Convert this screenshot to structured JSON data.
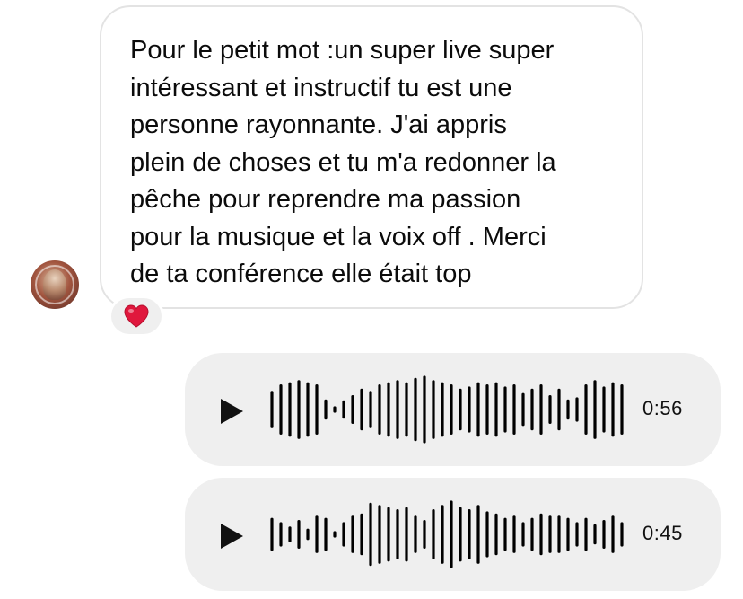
{
  "incoming_message": {
    "text": "Pour le petit mot :un super live super\nintéressant et instructif tu est une\npersonne rayonnante.  J'ai appris\nplein de choses et tu m'a redonner la\npêche pour reprendre ma passion\npour la musique et la voix off . Merci\nde ta conférence elle était top",
    "reaction_icon": "red-heart-icon",
    "reaction_color": "#e0173d"
  },
  "voice_messages": [
    {
      "duration": "0:56",
      "icons": {
        "play": "play-icon"
      },
      "waveform_levels": [
        0.4,
        0.55,
        0.6,
        0.65,
        0.6,
        0.55,
        0.2,
        0.02,
        0.18,
        0.3,
        0.45,
        0.4,
        0.55,
        0.6,
        0.65,
        0.6,
        0.7,
        0.75,
        0.65,
        0.6,
        0.55,
        0.45,
        0.5,
        0.6,
        0.55,
        0.6,
        0.5,
        0.55,
        0.35,
        0.45,
        0.55,
        0.3,
        0.45,
        0.2,
        0.25,
        0.55,
        0.65,
        0.5,
        0.6,
        0.55
      ]
    },
    {
      "duration": "0:45",
      "icons": {
        "play": "play-icon"
      },
      "waveform_levels": [
        0.35,
        0.25,
        0.15,
        0.3,
        0.1,
        0.4,
        0.35,
        0.02,
        0.25,
        0.4,
        0.45,
        0.7,
        0.65,
        0.6,
        0.55,
        0.6,
        0.4,
        0.3,
        0.55,
        0.65,
        0.75,
        0.6,
        0.55,
        0.65,
        0.5,
        0.45,
        0.35,
        0.4,
        0.25,
        0.35,
        0.45,
        0.4,
        0.4,
        0.35,
        0.25,
        0.35,
        0.2,
        0.3,
        0.4,
        0.25
      ]
    }
  ],
  "colors": {
    "bubble_gray": "#efefef",
    "bubble_border": "#e3e3e3",
    "waveform": "#000000"
  }
}
